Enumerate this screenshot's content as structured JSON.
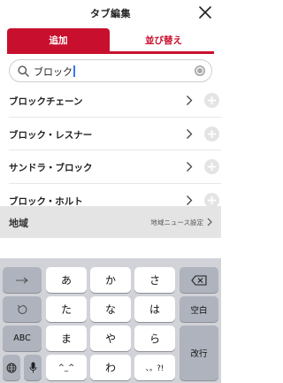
{
  "header": {
    "title": "タブ編集"
  },
  "tabs": [
    {
      "label": "追加",
      "active": true
    },
    {
      "label": "並び替え",
      "active": false
    }
  ],
  "search": {
    "value": "ブロック"
  },
  "results": [
    {
      "label": "ブロックチェーン"
    },
    {
      "label": "ブロック・レスナー"
    },
    {
      "label": "サンドラ・ブロック"
    },
    {
      "label": "ブロック・ホルト"
    }
  ],
  "region": {
    "title": "地域",
    "link": "地域ニュース設定"
  },
  "keyboard": {
    "row1": [
      "あ",
      "か",
      "さ"
    ],
    "row2": [
      "た",
      "な",
      "は"
    ],
    "row3": [
      "ま",
      "や",
      "ら"
    ],
    "row4": [
      "^_^",
      "わ",
      "、。?!"
    ],
    "abc": "ABC",
    "space": "空白",
    "enter": "改行"
  },
  "colors": {
    "accent": "#c8102e",
    "keyboard_bg": "#d1d3d9",
    "region_bg": "#e4e4e4"
  }
}
